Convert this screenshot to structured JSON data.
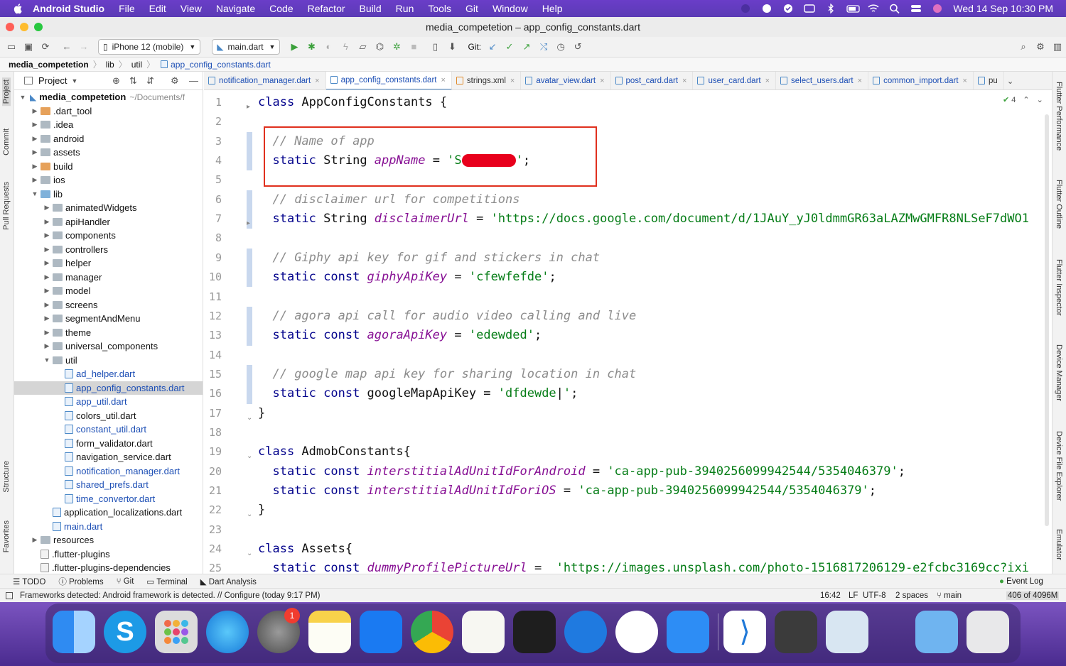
{
  "menubar": {
    "app": "Android Studio",
    "items": [
      "File",
      "Edit",
      "View",
      "Navigate",
      "Code",
      "Refactor",
      "Build",
      "Run",
      "Tools",
      "Git",
      "Window",
      "Help"
    ],
    "clock": "Wed 14 Sep  10:30 PM"
  },
  "window": {
    "title": "media_competetion – app_config_constants.dart"
  },
  "toolbar": {
    "device": "iPhone 12 (mobile)",
    "run_config": "main.dart",
    "git_label": "Git:"
  },
  "breadcrumb": [
    "media_competetion",
    "lib",
    "util",
    "app_config_constants.dart"
  ],
  "sidebar_left": {
    "tabs": [
      "Project",
      "Commit",
      "Pull Requests",
      "Structure",
      "Favorites"
    ]
  },
  "sidebar_right": {
    "tabs": [
      "Flutter Performance",
      "Flutter Outline",
      "Flutter Inspector",
      "Device Manager",
      "Device File Explorer",
      "Emulator"
    ]
  },
  "project_panel": {
    "title": "Project",
    "root": {
      "name": "media_competetion",
      "path": "~/Documents/f"
    },
    "items": [
      {
        "name": ".dart_tool",
        "depth": 1,
        "type": "folder-orange",
        "expandable": true
      },
      {
        "name": ".idea",
        "depth": 1,
        "type": "folder",
        "expandable": true
      },
      {
        "name": "android",
        "depth": 1,
        "type": "folder",
        "expandable": true
      },
      {
        "name": "assets",
        "depth": 1,
        "type": "folder",
        "expandable": true
      },
      {
        "name": "build",
        "depth": 1,
        "type": "folder-orange",
        "expandable": true
      },
      {
        "name": "ios",
        "depth": 1,
        "type": "folder",
        "expandable": true
      },
      {
        "name": "lib",
        "depth": 1,
        "type": "folder-blue",
        "expandable": true,
        "expanded": true
      },
      {
        "name": "animatedWidgets",
        "depth": 2,
        "type": "folder",
        "expandable": true
      },
      {
        "name": "apiHandler",
        "depth": 2,
        "type": "folder",
        "expandable": true
      },
      {
        "name": "components",
        "depth": 2,
        "type": "folder",
        "expandable": true
      },
      {
        "name": "controllers",
        "depth": 2,
        "type": "folder",
        "expandable": true
      },
      {
        "name": "helper",
        "depth": 2,
        "type": "folder",
        "expandable": true
      },
      {
        "name": "manager",
        "depth": 2,
        "type": "folder",
        "expandable": true
      },
      {
        "name": "model",
        "depth": 2,
        "type": "folder",
        "expandable": true
      },
      {
        "name": "screens",
        "depth": 2,
        "type": "folder",
        "expandable": true
      },
      {
        "name": "segmentAndMenu",
        "depth": 2,
        "type": "folder",
        "expandable": true
      },
      {
        "name": "theme",
        "depth": 2,
        "type": "folder",
        "expandable": true
      },
      {
        "name": "universal_components",
        "depth": 2,
        "type": "folder",
        "expandable": true
      },
      {
        "name": "util",
        "depth": 2,
        "type": "folder",
        "expandable": true,
        "expanded": true
      },
      {
        "name": "ad_helper.dart",
        "depth": 3,
        "type": "dart-blue"
      },
      {
        "name": "app_config_constants.dart",
        "depth": 3,
        "type": "dart-blue",
        "selected": true
      },
      {
        "name": "app_util.dart",
        "depth": 3,
        "type": "dart-blue"
      },
      {
        "name": "colors_util.dart",
        "depth": 3,
        "type": "dart"
      },
      {
        "name": "constant_util.dart",
        "depth": 3,
        "type": "dart-blue"
      },
      {
        "name": "form_validator.dart",
        "depth": 3,
        "type": "dart"
      },
      {
        "name": "navigation_service.dart",
        "depth": 3,
        "type": "dart"
      },
      {
        "name": "notification_manager.dart",
        "depth": 3,
        "type": "dart-blue"
      },
      {
        "name": "shared_prefs.dart",
        "depth": 3,
        "type": "dart-blue"
      },
      {
        "name": "time_convertor.dart",
        "depth": 3,
        "type": "dart-blue"
      },
      {
        "name": "application_localizations.dart",
        "depth": 2,
        "type": "dart"
      },
      {
        "name": "main.dart",
        "depth": 2,
        "type": "dart-blue"
      },
      {
        "name": "resources",
        "depth": 1,
        "type": "folder",
        "expandable": true
      },
      {
        "name": ".flutter-plugins",
        "depth": 1,
        "type": "file"
      },
      {
        "name": ".flutter-plugins-dependencies",
        "depth": 1,
        "type": "file"
      }
    ]
  },
  "editor_tabs": [
    {
      "label": "notification_manager.dart"
    },
    {
      "label": "app_config_constants.dart",
      "active": true
    },
    {
      "label": "strings.xml"
    },
    {
      "label": "avatar_view.dart"
    },
    {
      "label": "post_card.dart"
    },
    {
      "label": "user_card.dart"
    },
    {
      "label": "select_users.dart"
    },
    {
      "label": "common_import.dart"
    },
    {
      "label": "pu"
    }
  ],
  "editor": {
    "inspection_count": "4",
    "lines": [
      {
        "n": "1",
        "parts": [
          [
            "kw",
            "class "
          ],
          [
            "id",
            "AppConfigConstants {"
          ]
        ]
      },
      {
        "n": "2",
        "parts": []
      },
      {
        "n": "3",
        "parts": [
          [
            "id",
            "  "
          ],
          [
            "cm",
            "// Name of app"
          ]
        ]
      },
      {
        "n": "4",
        "parts": [
          [
            "id",
            "  "
          ],
          [
            "kw",
            "static "
          ],
          [
            "id",
            "String "
          ],
          [
            "fld",
            "appName"
          ],
          [
            "id",
            " = "
          ],
          [
            "str",
            "'S"
          ],
          [
            "redact",
            ""
          ],
          [
            "str",
            "'"
          ],
          [
            "id",
            ";"
          ]
        ]
      },
      {
        "n": "5",
        "parts": []
      },
      {
        "n": "6",
        "parts": [
          [
            "id",
            "  "
          ],
          [
            "cm",
            "// disclaimer url for competitions"
          ]
        ]
      },
      {
        "n": "7",
        "parts": [
          [
            "id",
            "  "
          ],
          [
            "kw",
            "static "
          ],
          [
            "id",
            "String "
          ],
          [
            "fld",
            "disclaimerUrl"
          ],
          [
            "id",
            " = "
          ],
          [
            "str",
            "'https://docs.google.com/document/d/1JAuY_yJ0ldmmGR63aLAZMwGMFR8NLSeF7dWO1"
          ]
        ]
      },
      {
        "n": "8",
        "parts": []
      },
      {
        "n": "9",
        "parts": [
          [
            "id",
            "  "
          ],
          [
            "cm",
            "// Giphy api key for gif and stickers in chat"
          ]
        ]
      },
      {
        "n": "10",
        "parts": [
          [
            "id",
            "  "
          ],
          [
            "kw",
            "static const "
          ],
          [
            "fld",
            "giphyApiKey"
          ],
          [
            "id",
            " = "
          ],
          [
            "str",
            "'cfewfefde'"
          ],
          [
            "id",
            ";"
          ]
        ]
      },
      {
        "n": "11",
        "parts": []
      },
      {
        "n": "12",
        "parts": [
          [
            "id",
            "  "
          ],
          [
            "cm",
            "// agora api call for audio video calling and live"
          ]
        ]
      },
      {
        "n": "13",
        "parts": [
          [
            "id",
            "  "
          ],
          [
            "kw",
            "static const "
          ],
          [
            "fld",
            "agoraApiKey"
          ],
          [
            "id",
            " = "
          ],
          [
            "str",
            "'edewded'"
          ],
          [
            "id",
            ";"
          ]
        ]
      },
      {
        "n": "14",
        "parts": []
      },
      {
        "n": "15",
        "parts": [
          [
            "id",
            "  "
          ],
          [
            "cm",
            "// google map api key for sharing location in chat"
          ]
        ]
      },
      {
        "n": "16",
        "parts": [
          [
            "id",
            "  "
          ],
          [
            "kw",
            "static const "
          ],
          [
            "id",
            "googleMapApiKey = "
          ],
          [
            "str",
            "'dfdewde"
          ],
          [
            "id",
            "|"
          ],
          [
            "str",
            "'"
          ],
          [
            "id",
            ";"
          ]
        ]
      },
      {
        "n": "17",
        "parts": [
          [
            "id",
            "}"
          ]
        ]
      },
      {
        "n": "18",
        "parts": []
      },
      {
        "n": "19",
        "parts": [
          [
            "kw",
            "class "
          ],
          [
            "id",
            "AdmobConstants{"
          ]
        ]
      },
      {
        "n": "20",
        "parts": [
          [
            "id",
            "  "
          ],
          [
            "kw",
            "static const "
          ],
          [
            "fld",
            "interstitialAdUnitIdForAndroid"
          ],
          [
            "id",
            " = "
          ],
          [
            "str",
            "'ca-app-pub-3940256099942544/5354046379'"
          ],
          [
            "id",
            ";"
          ]
        ]
      },
      {
        "n": "21",
        "parts": [
          [
            "id",
            "  "
          ],
          [
            "kw",
            "static const "
          ],
          [
            "fld",
            "interstitialAdUnitIdForiOS"
          ],
          [
            "id",
            " = "
          ],
          [
            "str",
            "'ca-app-pub-3940256099942544/5354046379'"
          ],
          [
            "id",
            ";"
          ]
        ]
      },
      {
        "n": "22",
        "parts": [
          [
            "id",
            "}"
          ]
        ]
      },
      {
        "n": "23",
        "parts": []
      },
      {
        "n": "24",
        "parts": [
          [
            "kw",
            "class "
          ],
          [
            "id",
            "Assets{"
          ]
        ]
      },
      {
        "n": "25",
        "parts": [
          [
            "id",
            "  "
          ],
          [
            "kw",
            "static const "
          ],
          [
            "fld",
            "dummyProfilePictureUrl"
          ],
          [
            "id",
            " =  "
          ],
          [
            "str",
            "'https://images.unsplash.com/photo-1516817206129-e2fcbc3169cc?ixi"
          ]
        ]
      }
    ]
  },
  "bottom_tools": [
    "TODO",
    "Problems",
    "Git",
    "Terminal",
    "Dart Analysis"
  ],
  "bottom_right": "Event Log",
  "status": {
    "message": "Frameworks detected: Android framework is detected. // Configure (today 9:17 PM)",
    "position": "16:42",
    "line_sep": "LF",
    "encoding": "UTF-8",
    "indent": "2 spaces",
    "branch": "main",
    "memory": "406 of 4096M"
  },
  "dock": {
    "badge": "1"
  }
}
